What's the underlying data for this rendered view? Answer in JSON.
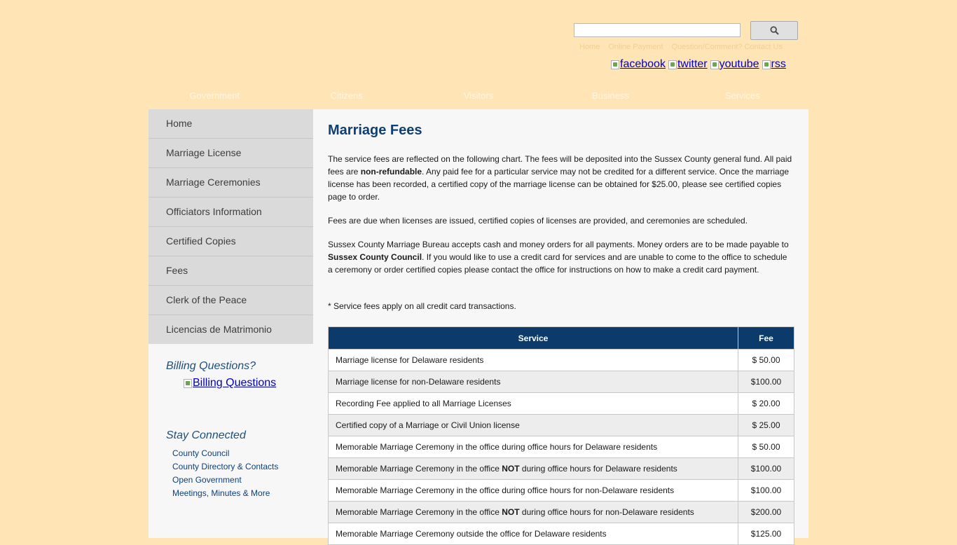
{
  "header": {
    "search_placeholder": "",
    "search_icon": "search-icon",
    "top_links": [
      "Home",
      "Online Payment",
      "Question/Comment? Contact Us"
    ],
    "social": [
      {
        "alt": "facebook",
        "icon": "facebook-icon"
      },
      {
        "alt": "twitter",
        "icon": "twitter-icon"
      },
      {
        "alt": "youtube",
        "icon": "youtube-icon"
      },
      {
        "alt": "rss",
        "icon": "rss-icon"
      }
    ],
    "main_nav": [
      "Government",
      "Citizens",
      "Visitors",
      "Business",
      "Services"
    ]
  },
  "sidebar": {
    "items": [
      "Home",
      "Marriage License",
      "Marriage Ceremonies",
      "Officiators Information",
      "Certified Copies",
      "Fees",
      "Clerk of the Peace",
      "Licencias de Matrimonio"
    ],
    "billing_title": "Billing Questions?",
    "billing_link": "Billing Questions",
    "stay_title": "Stay Connected",
    "stay_links": [
      "County Council",
      "County Directory & Contacts",
      "Open Government",
      "Meetings, Minutes & More"
    ]
  },
  "main": {
    "title": "Marriage Fees",
    "p1_a": "The service fees are reflected on the following chart.  The fees will be deposited into the Sussex County general fund.  All paid fees are ",
    "p1_b": "non-refundable",
    "p1_c": ". Any paid fee for a particular service may not be credited for a different service.  Once the marriage license has been recorded, a certified copy of the marriage license can be obtained for $25.00, please see certified copies page to order.",
    "p2": "Fees are due when licenses are issued, certified copies of licenses are provided, and ceremonies are scheduled.",
    "p3_a": "Sussex County Marriage Bureau accepts cash and money orders for all payments. Money orders are to be made payable to ",
    "p3_b": "Sussex County Council",
    "p3_c": ". If you would like to use a credit card for services and are unable to come to the office to schedule a ceremony or order certified copies please contact the office for instructions on how to make a credit card payment.",
    "p4": "* Service fees apply on all credit card transactions.",
    "table": {
      "headers": [
        "Service",
        "Fee"
      ],
      "rows": [
        {
          "pre": "Marriage license for Delaware residents",
          "bold": "",
          "post": "",
          "fee": "$ 50.00"
        },
        {
          "pre": "Marriage license for non-Delaware residents",
          "bold": "",
          "post": "",
          "fee": "$100.00"
        },
        {
          "pre": "Recording Fee applied to all Marriage Licenses",
          "bold": "",
          "post": "",
          "fee": "$ 20.00"
        },
        {
          "pre": "Certified copy of a Marriage or Civil Union license",
          "bold": "",
          "post": "",
          "fee": "$ 25.00"
        },
        {
          "pre": "Memorable Marriage Ceremony in the office during office hours for Delaware residents",
          "bold": "",
          "post": "",
          "fee": "$ 50.00"
        },
        {
          "pre": "Memorable Marriage Ceremony in the office ",
          "bold": "NOT",
          "post": " during office hours for Delaware residents",
          "fee": "$100.00"
        },
        {
          "pre": "Memorable Marriage Ceremony in the office during office hours for non-Delaware residents",
          "bold": "",
          "post": "",
          "fee": "$100.00"
        },
        {
          "pre": "Memorable Marriage Ceremony in the office ",
          "bold": "NOT",
          "post": " during office hours for non-Delaware residents",
          "fee": "$200.00"
        },
        {
          "pre": "Memorable Marriage Ceremony outside the office for Delaware residents",
          "bold": "",
          "post": "",
          "fee": "$125.00"
        }
      ]
    }
  }
}
